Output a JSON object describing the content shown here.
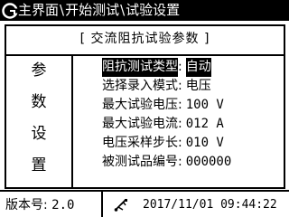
{
  "titlebar": {
    "logo_icon": "brand-logo-icon",
    "breadcrumb": [
      "主界面",
      "开始测试",
      "试验设置"
    ],
    "separator": "\\"
  },
  "panel": {
    "title": "[ 交流阻抗试验参数 ]",
    "side_label": [
      "参",
      "数",
      "设",
      "置"
    ],
    "rows": [
      {
        "label": "阻抗测试类型",
        "colon": ":",
        "value": "自动",
        "selected": true
      },
      {
        "label": "选择录入模式",
        "colon": ":",
        "value": "电压",
        "selected": false
      },
      {
        "label": "最大试验电压",
        "colon": ":",
        "value": "100 V",
        "selected": false
      },
      {
        "label": "最大试验电流",
        "colon": ":",
        "value": "012 A",
        "selected": false
      },
      {
        "label": "电压采样步长",
        "colon": ":",
        "value": "010 V",
        "selected": false
      },
      {
        "label": "被测试品编号",
        "colon": ":",
        "value": "000000",
        "selected": false
      }
    ]
  },
  "statusbar": {
    "version_label": "版本号:",
    "version_value": "2.0",
    "usb_icon": "usb-icon",
    "datetime": "2017/11/01 09:44:22"
  },
  "colors": {
    "foreground": "#000000",
    "background": "#ffffff"
  }
}
